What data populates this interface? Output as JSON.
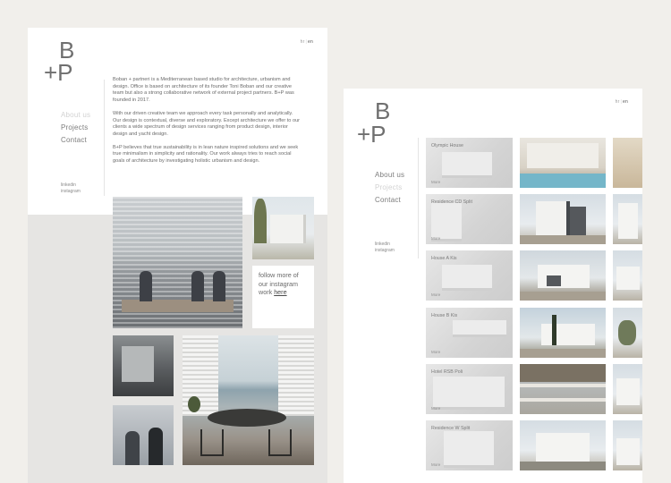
{
  "brand": {
    "logo_top": "B",
    "logo_bottom": "+P"
  },
  "lang": {
    "hr": "hr",
    "sep": "|",
    "en": "en"
  },
  "left_page": {
    "nav": [
      {
        "label": "About us",
        "active": true
      },
      {
        "label": "Projects",
        "active": false
      },
      {
        "label": "Contact",
        "active": false
      }
    ],
    "social": [
      "linkedin",
      "instagram"
    ],
    "about": [
      "Boban + partneri is a Mediterranean based studio for architecture, urbanism and design. Office is based on architecture of its founder Toni Boban and our creative team but also a strong collaborative network of external project partners. B+P was founded in 2017.",
      "With our driven creative team we approach every task personally and analytically. Our design is contextual, diverse and exploratory. Except architecture we offer to our clients a wide spectrum of design services ranging from product design, interior design and yacht design.",
      "B+P believes that true sustainability is in lean nature inspired solutions and we seek true minimalism in simplicity and rationality. Our work always tries to reach social goals of architecture by investigating holistic urbanism and design."
    ],
    "follow": {
      "text": "follow more of our instagram work",
      "link": "here"
    }
  },
  "right_page": {
    "nav": [
      {
        "label": "About us",
        "active": false
      },
      {
        "label": "Projects",
        "active": true
      },
      {
        "label": "Contact",
        "active": false
      }
    ],
    "social": [
      "linkedin",
      "instagram"
    ],
    "projects": [
      {
        "name": "Olympic House",
        "more": "More"
      },
      {
        "name": "Residence CD Split",
        "more": "More"
      },
      {
        "name": "House A Kis",
        "more": "More"
      },
      {
        "name": "House B Kis",
        "more": "More"
      },
      {
        "name": "Hotel RSB Poli",
        "more": "More"
      },
      {
        "name": "Residence W Split",
        "more": "More"
      }
    ]
  }
}
